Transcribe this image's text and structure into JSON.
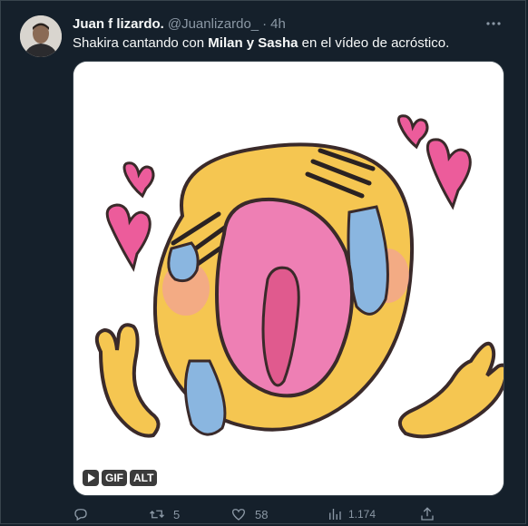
{
  "tweet": {
    "display_name": "Juan f lizardo.",
    "handle": "@Juanlizardo_",
    "separator": "·",
    "time": "4h",
    "text_parts": {
      "before": "Shakira cantando con ",
      "bold": "Milan y Sasha",
      "after": " en el vídeo de acróstico."
    }
  },
  "media": {
    "badge_gif": "GIF",
    "badge_alt": "ALT"
  },
  "actions": {
    "reply_count": "",
    "retweet_count": "5",
    "like_count": "58",
    "views_count": "1.174"
  },
  "icons": {
    "reply": "reply-icon",
    "retweet": "retweet-icon",
    "like": "heart-icon",
    "views": "views-icon",
    "share": "share-icon",
    "more": "more-icon",
    "play": "play-icon"
  },
  "colors": {
    "background": "#15202b",
    "text": "#f7f9f9",
    "muted": "#8b98a5"
  }
}
